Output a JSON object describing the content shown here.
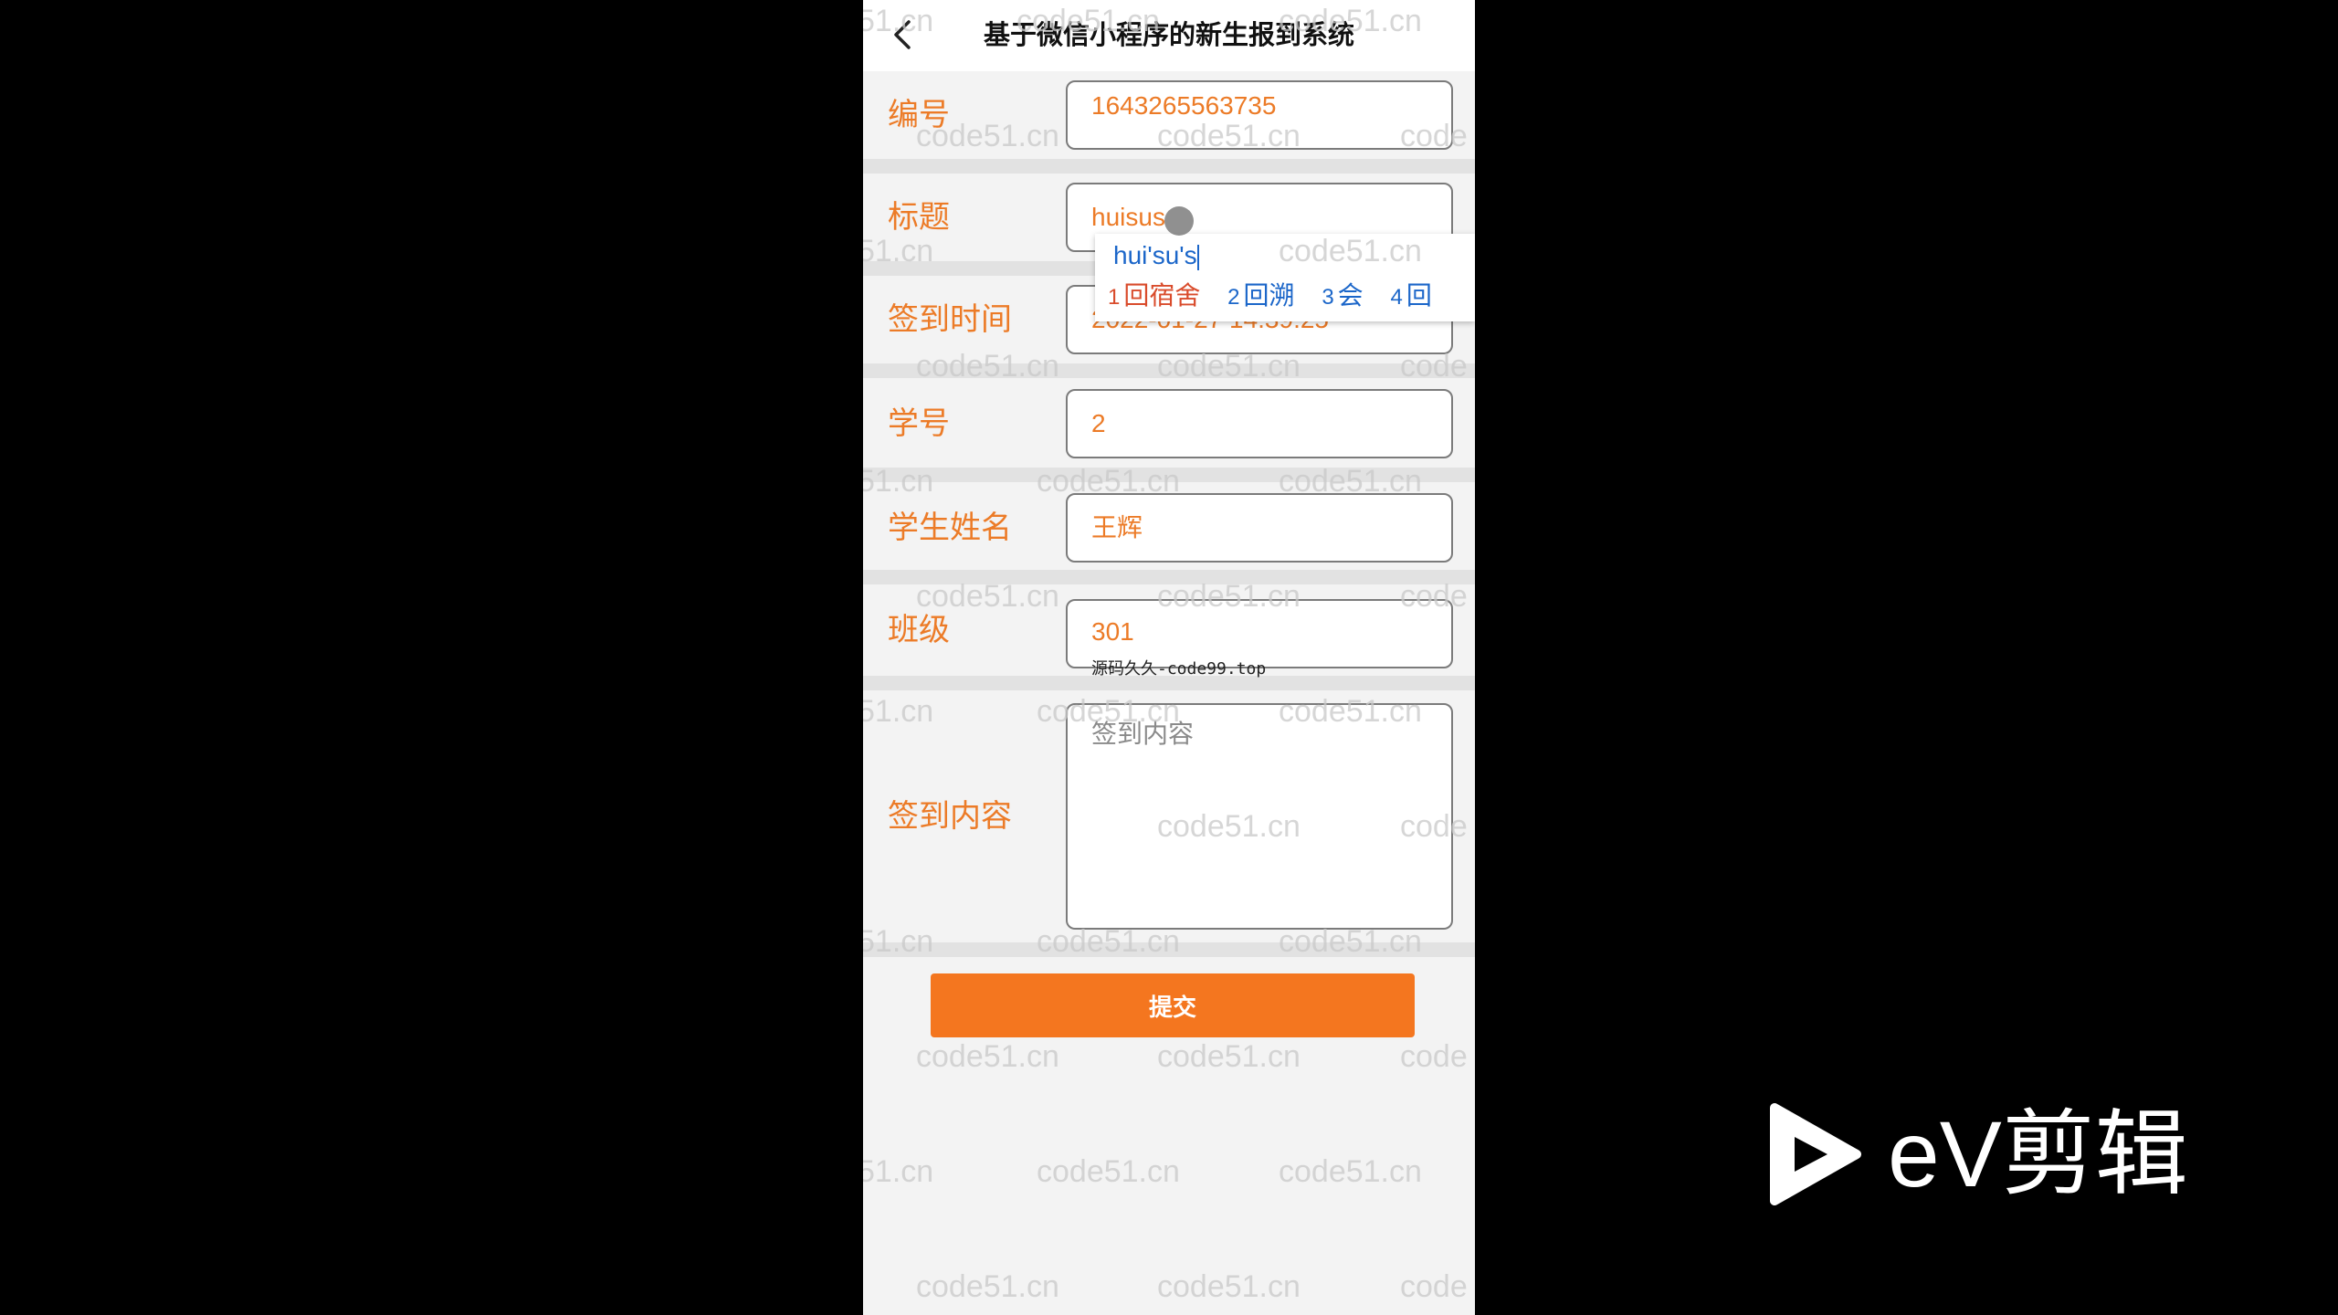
{
  "nav": {
    "title": "基于微信小程序的新生报到系统"
  },
  "form": {
    "fields": [
      {
        "label": "编号",
        "value": "1643265563735"
      },
      {
        "label": "标题",
        "value": "huisus"
      },
      {
        "label": "签到时间",
        "value": "2022-01-27 14:39:25"
      },
      {
        "label": "学号",
        "value": "2"
      },
      {
        "label": "学生姓名",
        "value": "王辉"
      },
      {
        "label": "班级",
        "value": "301"
      },
      {
        "label": "签到内容",
        "placeholder": "签到内容"
      }
    ],
    "submit_label": "提交"
  },
  "ime": {
    "composition": "hui'su's",
    "candidates": [
      {
        "num": "1",
        "text": "回宿舍"
      },
      {
        "num": "2",
        "text": "回溯"
      },
      {
        "num": "3",
        "text": "会"
      },
      {
        "num": "4",
        "text": "回"
      }
    ]
  },
  "overlay_note": "源码久久-code99.top",
  "watermark_text": "code51.cn",
  "watermark_text_partial_left": "51.cn",
  "watermark_text_partial_right": "code",
  "brand": {
    "name": "eV剪辑",
    "logo_icon": "play-triangle-icon"
  },
  "colors": {
    "accent": "#f4761f",
    "label": "#ec7b27",
    "page_bg": "#f3f3f3",
    "outside_bg": "#000000"
  }
}
